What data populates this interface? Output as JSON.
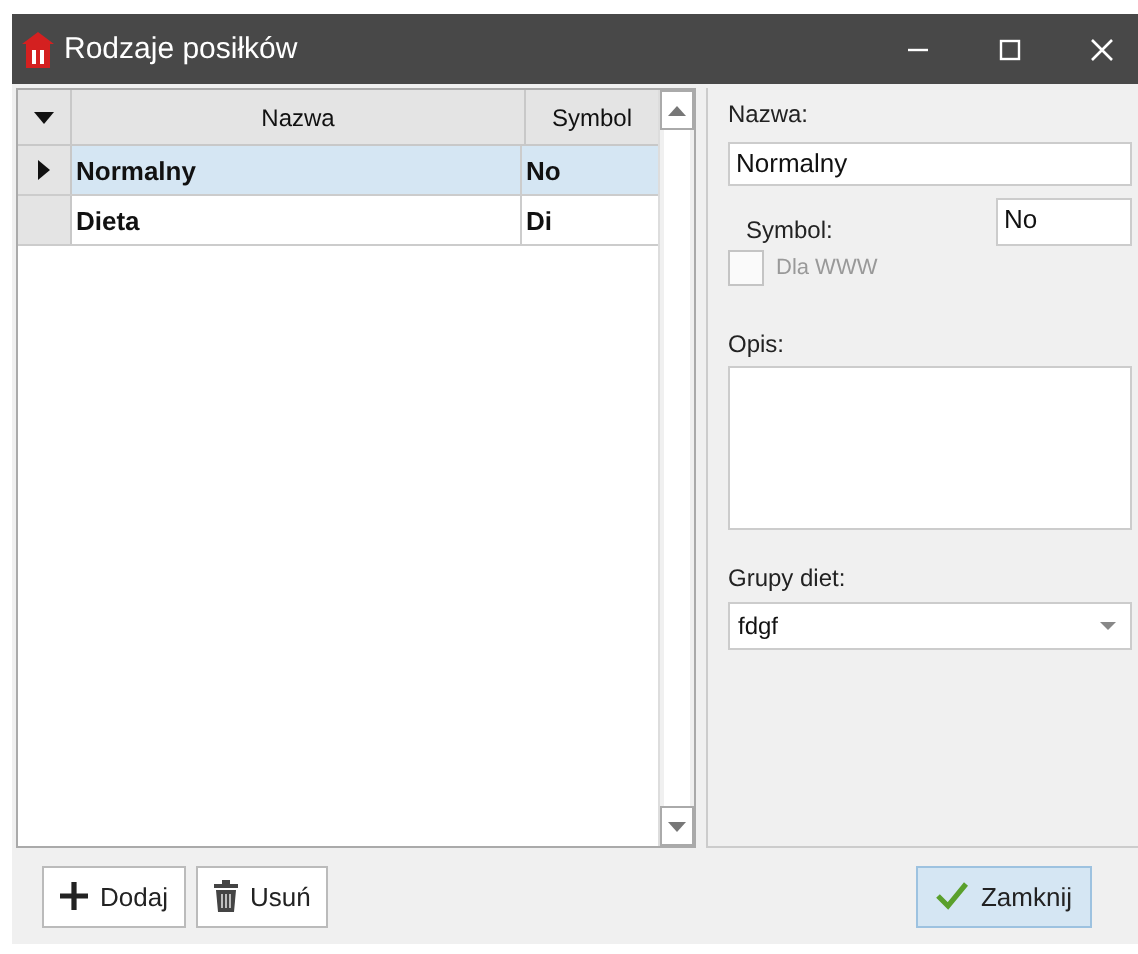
{
  "window": {
    "title": "Rodzaje posiłków"
  },
  "grid": {
    "columns": [
      "Nazwa",
      "Symbol"
    ],
    "rows": [
      {
        "name": "Normalny",
        "symbol": "No",
        "selected": true
      },
      {
        "name": "Dieta",
        "symbol": "Di",
        "selected": false
      }
    ]
  },
  "form": {
    "name_label": "Nazwa:",
    "name_value": "Normalny",
    "symbol_label": "Symbol:",
    "symbol_value": "No",
    "checkbox": {
      "label": "Dla WWW",
      "checked": false,
      "disabled": true
    },
    "description_label": "Opis:",
    "group_label": "Grupy diet:",
    "group_value": "fdgf"
  },
  "buttons": [
    {
      "kind": "add",
      "label": "Dodaj",
      "highlighted": false
    },
    {
      "kind": "delete",
      "label": "Usuń",
      "highlighted": false
    },
    {
      "kind": "close",
      "label": "Zamknij",
      "highlighted": true
    }
  ]
}
